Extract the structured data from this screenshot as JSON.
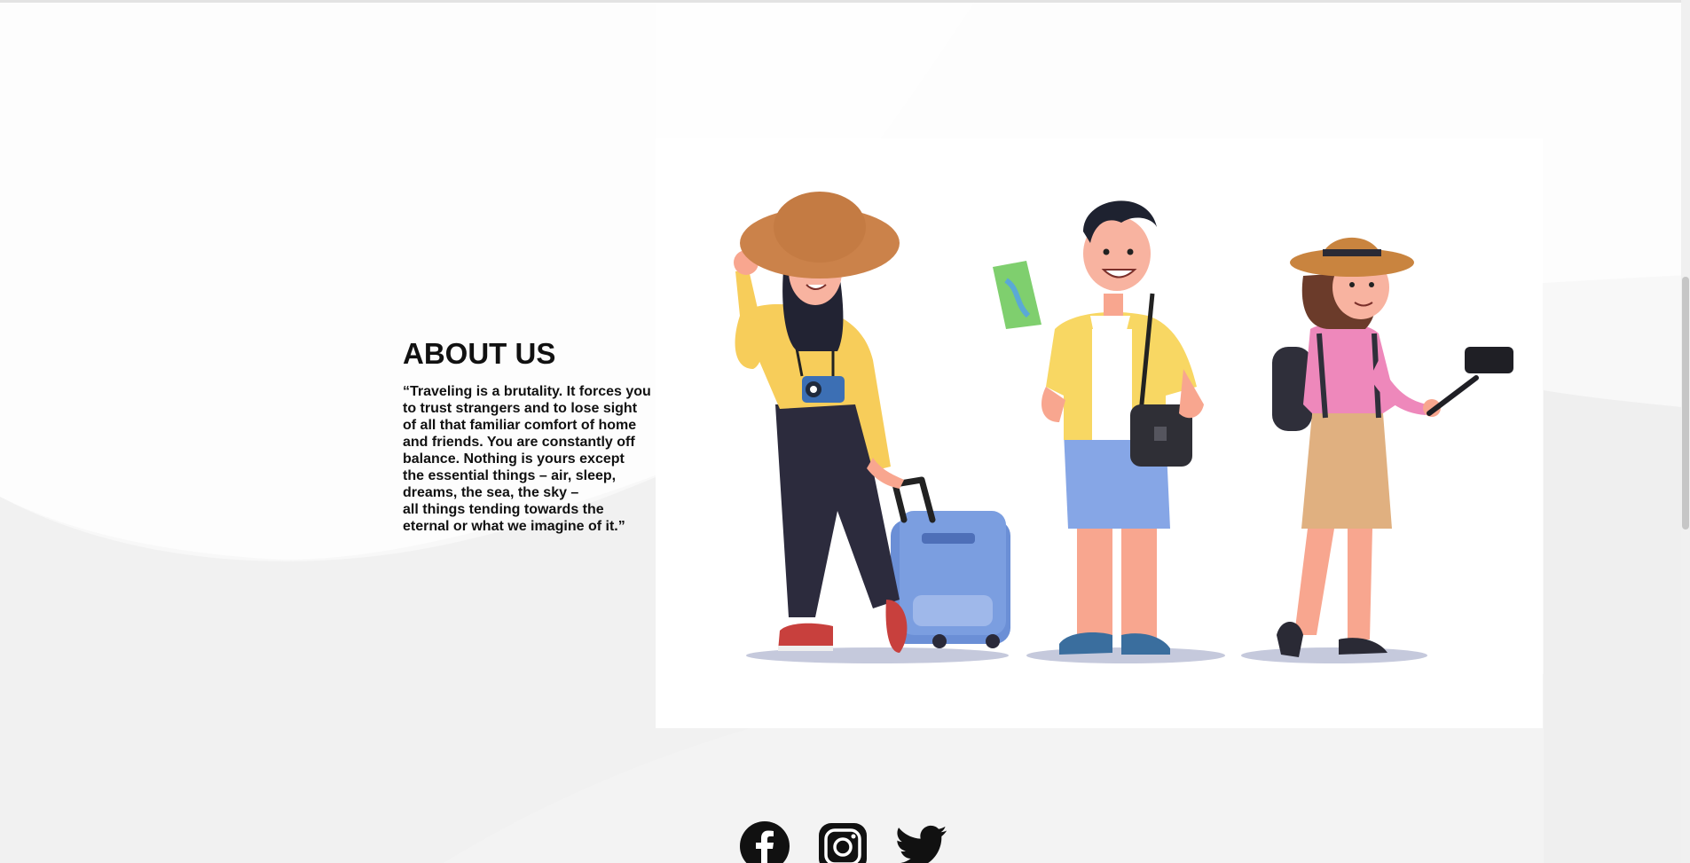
{
  "about": {
    "title": "ABOUT US",
    "quote_lines": [
      "“Traveling is a brutality. It forces you",
      "to trust strangers and to lose sight",
      "of all that familiar comfort of home",
      "and friends. You are constantly off",
      "balance. Nothing is yours except",
      "the essential things – air, sleep,",
      "dreams, the sea, the sky –",
      "all things tending towards the",
      "eternal or what we imagine of it.”"
    ]
  },
  "illustration": {
    "description_icon": "travelers-illustration"
  },
  "social": [
    {
      "icon": "facebook-icon"
    },
    {
      "icon": "instagram-icon"
    },
    {
      "icon": "twitter-icon"
    }
  ],
  "colors": {
    "page_background": "#f7f7f7",
    "text": "#111111",
    "social_icons": "#111111"
  }
}
